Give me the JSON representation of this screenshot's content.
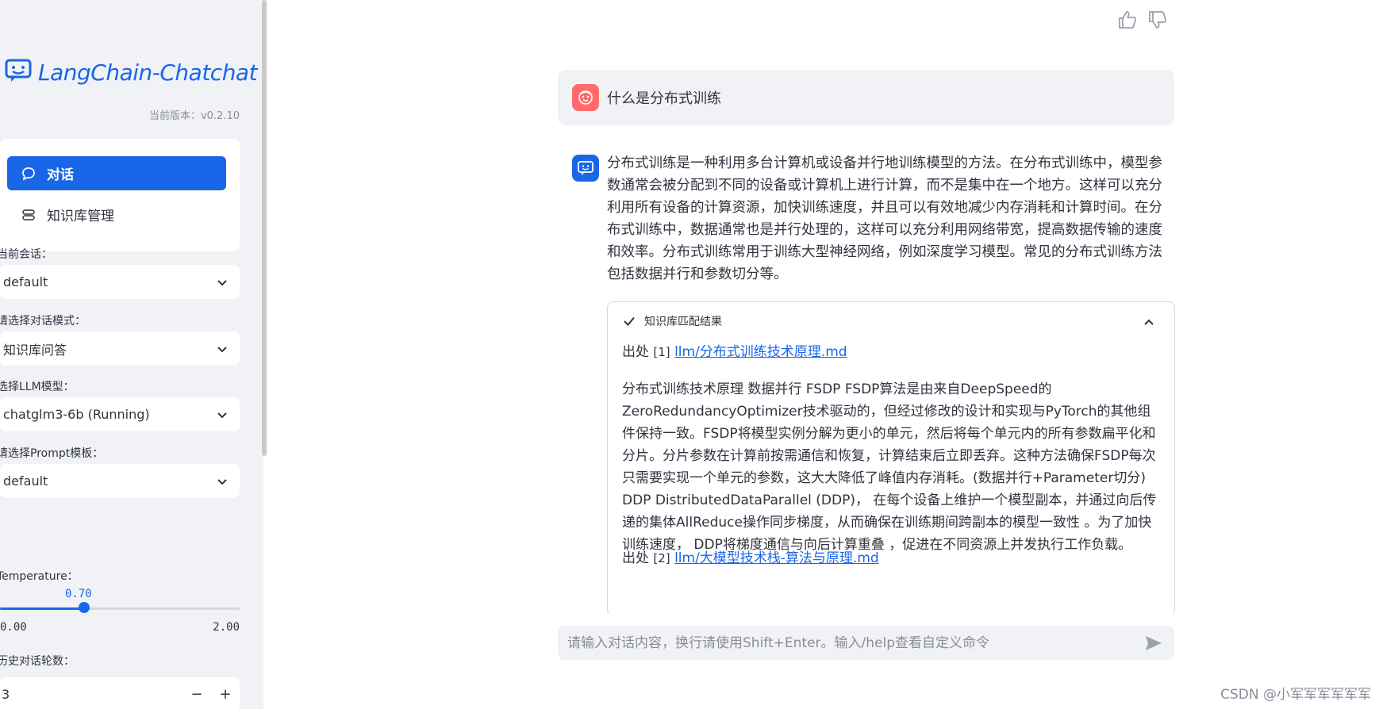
{
  "sidebar": {
    "app_title": "LangChain-Chatchat",
    "version": "当前版本：v0.2.10",
    "menu": [
      {
        "label": "对话",
        "icon": "chat-bubble-icon",
        "active": true
      },
      {
        "label": "知识库管理",
        "icon": "database-icon",
        "active": false
      }
    ],
    "session_label": "当前会话：",
    "session_value": "default",
    "mode_label": "请选择对话模式：",
    "mode_value": "知识库问答",
    "llm_label": "选择LLM模型：",
    "llm_value": "chatglm3-6b (Running)",
    "prompt_label": "请选择Prompt模板：",
    "prompt_value": "default",
    "temperature_label": "Temperature：",
    "temperature_value": "0.70",
    "temperature_fraction": 0.35,
    "temperature_min": "0.00",
    "temperature_max": "2.00",
    "history_label": "历史对话轮数：",
    "history_value": "3",
    "minus": "−",
    "plus": "+"
  },
  "chat": {
    "user_message": "什么是分布式训练",
    "bot_message": "分布式训练是一种利用多台计算机或设备并行地训练模型的方法。在分布式训练中，模型参数通常会被分配到不同的设备或计算机上进行计算，而不是集中在一个地方。这样可以充分利用所有设备的计算资源，加快训练速度，并且可以有效地减少内存消耗和计算时间。在分布式训练中，数据通常也是并行处理的，这样可以充分利用网络带宽，提高数据传输的速度和效率。分布式训练常用于训练大型神经网络，例如深度学习模型。常见的分布式训练方法包括数据并行和参数切分等。",
    "kb": {
      "header": "知识库匹配结果",
      "sources": [
        {
          "prefix": "出处",
          "index": "[1]",
          "link": "llm/分布式训练技术原理.md"
        },
        {
          "prefix": "出处",
          "index": "[2]",
          "link": "llm/大模型技术栈-算法与原理.md"
        }
      ],
      "paragraph": "分布式训练技术原理 数据并行 FSDP FSDP算法是由来自DeepSpeed的ZeroRedundancyOptimizer技术驱动的，但经过修改的设计和实现与PyTorch的其他组件保持一致。FSDP将模型实例分解为更小的单元，然后将每个单元内的所有参数扁平化和分片。分片参数在计算前按需通信和恢复，计算结束后立即丢弃。这种方法确保FSDP每次只需要实现一个单元的参数，这大大降低了峰值内存消耗。(数据并行+Parameter切分) DDP DistributedDataParallel (DDP)， 在每个设备上维护一个模型副本，并通过向后传递的集体AllReduce操作同步梯度，从而确保在训练期间跨副本的模型一致性 。为了加快训练速度， DDP将梯度通信与向后计算重叠 ，促进在不同资源上并发执行工作负载。"
    },
    "input_placeholder": "请输入对话内容，换行请使用Shift+Enter。输入/help查看自定义命令"
  },
  "watermark": "CSDN @小军军军军军军",
  "colors": {
    "accent": "#1a66e8",
    "user_avatar": "#ff6b6b",
    "sidebar_bg": "#f0f2f6"
  }
}
